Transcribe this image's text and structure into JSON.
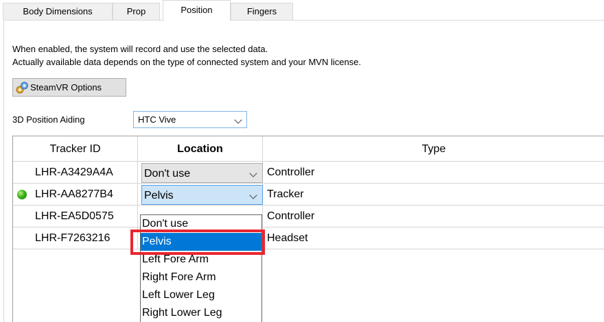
{
  "tabs": [
    {
      "label": "Body Dimensions",
      "active": false
    },
    {
      "label": "Prop",
      "active": false
    },
    {
      "label": "Position",
      "active": true
    },
    {
      "label": "Fingers",
      "active": false
    }
  ],
  "info": {
    "line1": "When enabled, the system will record and use the selected data.",
    "line2": "Actually available data depends on the type of connected system and your MVN license."
  },
  "steamvr_button": {
    "label": "SteamVR Options",
    "icon": "steamvr-gear-icon"
  },
  "position_aiding": {
    "label": "3D Position Aiding",
    "value": "HTC Vive"
  },
  "table": {
    "headers": {
      "id": "Tracker ID",
      "location": "Location",
      "type": "Type"
    },
    "rows": [
      {
        "id": "LHR-A3429A4A",
        "location": "Don't use",
        "type": "Controller",
        "status": ""
      },
      {
        "id": "LHR-AA8277B4",
        "location": "Pelvis",
        "type": "Tracker",
        "status": "connected"
      },
      {
        "id": "LHR-EA5D0575",
        "location": "",
        "type": "Controller",
        "status": ""
      },
      {
        "id": "LHR-F7263216",
        "location": "",
        "type": "Headset",
        "status": ""
      }
    ]
  },
  "location_dropdown": {
    "options": [
      "Don't use",
      "Pelvis",
      "Left Fore Arm",
      "Right Fore Arm",
      "Left Lower Leg",
      "Right Lower Leg"
    ],
    "selected": "Pelvis"
  },
  "colors": {
    "selection": "#0078d7",
    "highlight_box": "#e8262f",
    "status_ok": "#3bb21a"
  }
}
